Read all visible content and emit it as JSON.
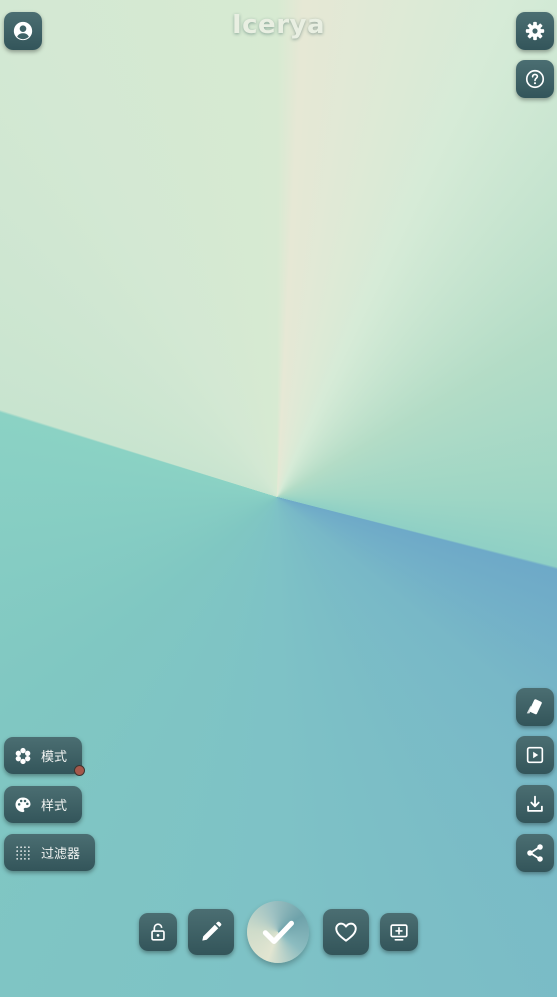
{
  "app": {
    "logo_text": "Icerya"
  },
  "side_menu": {
    "pattern_label": "模式",
    "style_label": "样式",
    "filter_label": "过滤器"
  },
  "icons": {
    "top_left": "user-account-icon",
    "top_right": [
      "gear-icon",
      "help-icon"
    ],
    "right_column": [
      "eraser-icon",
      "play-preview-icon",
      "download-icon",
      "share-icon"
    ],
    "bottom_bar": [
      "lock-open-icon",
      "pencil-icon",
      "checkmark-icon",
      "heart-icon",
      "add-to-screen-icon"
    ]
  },
  "colors": {
    "button_bg": "#3f6266",
    "button_icon": "#ffffff",
    "notification_dot": "#a5584b",
    "logo_text": "#e9efe2"
  }
}
